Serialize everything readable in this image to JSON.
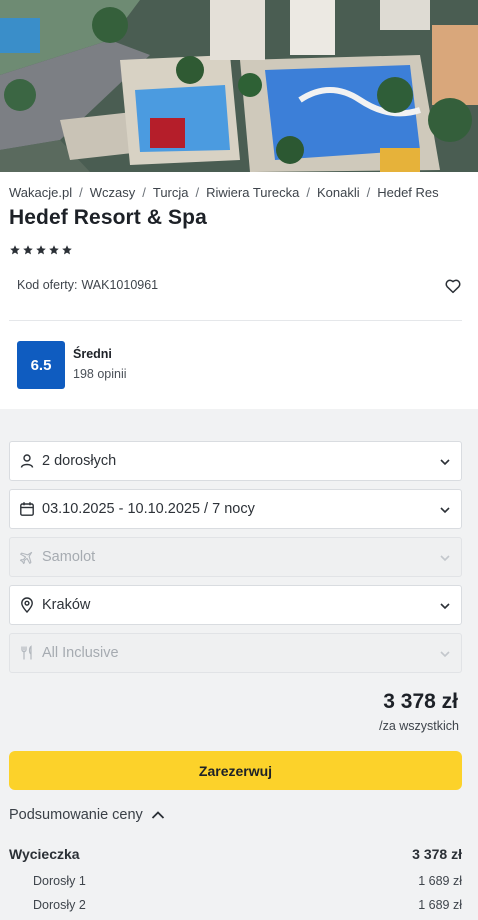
{
  "hero": {
    "alt_icon": "hotel-photo"
  },
  "breadcrumb": [
    "Wakacje.pl",
    "Wczasy",
    "Turcja",
    "Riwiera Turecka",
    "Konakli",
    "Hedef Res"
  ],
  "hotel": {
    "name": "Hedef Resort & Spa",
    "stars": 5,
    "offer_label": "Kod oferty:",
    "offer_code": "WAK1010961"
  },
  "rating": {
    "score": "6.5",
    "label": "Średni",
    "reviews": "198 opinii",
    "color": "#0f5cc0"
  },
  "form": {
    "guests": "2 dorosłych",
    "dates": "03.10.2025 - 10.10.2025 / 7 nocy",
    "transport": "Samolot",
    "departure": "Kraków",
    "board": "All Inclusive"
  },
  "price": {
    "total": "3 378 zł",
    "note": "/za wszystkich"
  },
  "booking": {
    "button_label": "Zarezerwuj",
    "button_color": "#fcd22a"
  },
  "summary": {
    "toggle_label": "Podsumowanie ceny",
    "trip_label": "Wycieczka",
    "trip_total": "3 378 zł",
    "lines": [
      {
        "label": "Dorosły 1",
        "value": "1 689 zł"
      },
      {
        "label": "Dorosły 2",
        "value": "1 689 zł"
      }
    ]
  }
}
